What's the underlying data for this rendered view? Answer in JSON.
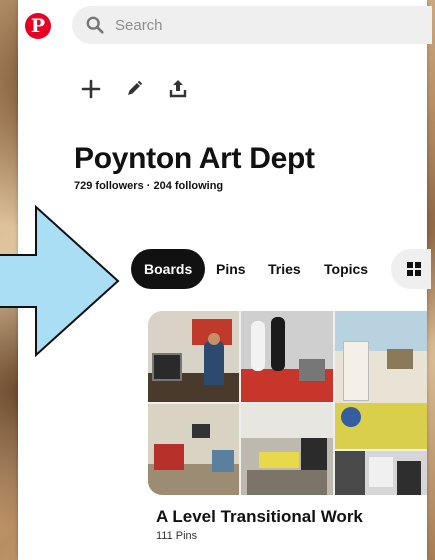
{
  "topbar": {
    "logo_letter": "P",
    "search_placeholder": "Search"
  },
  "toolbar": {
    "icons": [
      "plus-icon",
      "pencil-icon",
      "share-icon"
    ]
  },
  "profile": {
    "name": "Poynton Art Dept",
    "stats": "729 followers · 204 following"
  },
  "tabs": [
    {
      "label": "Boards",
      "active": true
    },
    {
      "label": "Pins",
      "active": false
    },
    {
      "label": "Tries",
      "active": false
    },
    {
      "label": "Topics",
      "active": false
    }
  ],
  "board": {
    "title": "A Level Transitional Work",
    "pin_count": "111 Pins"
  },
  "colors": {
    "brand": "#e60023",
    "arrow_fill": "#a9def5",
    "arrow_stroke": "#111111"
  }
}
